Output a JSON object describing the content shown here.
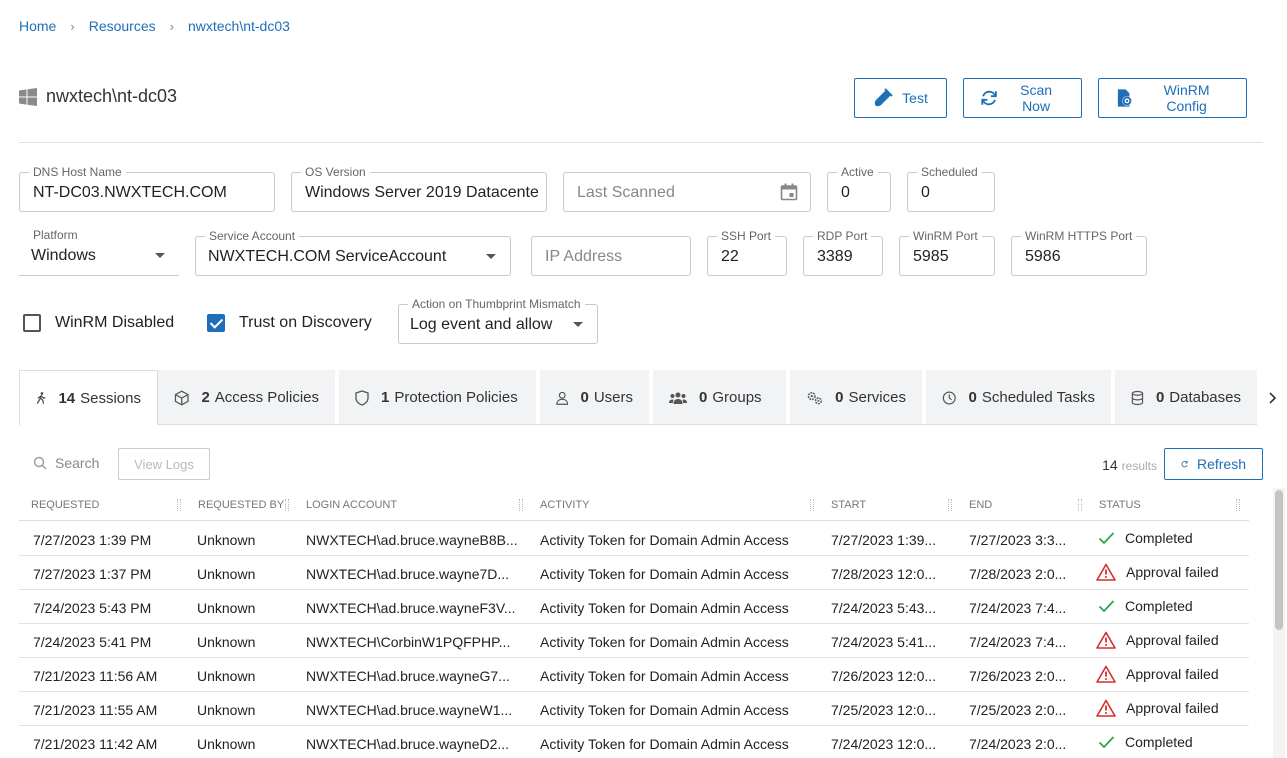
{
  "breadcrumb": {
    "home": "Home",
    "resources": "Resources",
    "current": "nwxtech\\nt-dc03"
  },
  "header": {
    "title": "nwxtech\\nt-dc03"
  },
  "actions": {
    "test": "Test",
    "scan_now": "Scan Now",
    "winrm_config": "WinRM Config"
  },
  "colors": {
    "accent": "#1e6fb8",
    "success": "#2aa84a",
    "error": "#d32f2f"
  },
  "fields": {
    "dns_host_name": {
      "label": "DNS Host Name",
      "value": "NT-DC03.NWXTECH.COM"
    },
    "os_version": {
      "label": "OS Version",
      "value": "Windows Server 2019 Datacente"
    },
    "last_scanned": {
      "placeholder": "Last Scanned"
    },
    "active": {
      "label": "Active",
      "value": "0"
    },
    "scheduled": {
      "label": "Scheduled",
      "value": "0"
    },
    "platform": {
      "label": "Platform",
      "value": "Windows"
    },
    "service_account": {
      "label": "Service Account",
      "value": "NWXTECH.COM ServiceAccount"
    },
    "ip_address": {
      "placeholder": "IP Address"
    },
    "ssh_port": {
      "label": "SSH Port",
      "value": "22"
    },
    "rdp_port": {
      "label": "RDP Port",
      "value": "3389"
    },
    "winrm_port": {
      "label": "WinRM Port",
      "value": "5985"
    },
    "winrm_https_port": {
      "label": "WinRM HTTPS Port",
      "value": "5986"
    },
    "thumbprint_action": {
      "label": "Action on Thumbprint Mismatch",
      "value": "Log event and allow"
    }
  },
  "checkboxes": {
    "winrm_disabled": {
      "label": "WinRM Disabled",
      "checked": false
    },
    "trust_on_discovery": {
      "label": "Trust on Discovery",
      "checked": true
    }
  },
  "tabs": [
    {
      "count": "14",
      "label": "Sessions",
      "icon": "walking-person-icon"
    },
    {
      "count": "2",
      "label": "Access Policies",
      "icon": "cube-icon"
    },
    {
      "count": "1",
      "label": "Protection Policies",
      "icon": "shield-icon"
    },
    {
      "count": "0",
      "label": "Users",
      "icon": "user-icon"
    },
    {
      "count": "0",
      "label": "Groups",
      "icon": "group-icon"
    },
    {
      "count": "0",
      "label": "Services",
      "icon": "gears-icon"
    },
    {
      "count": "0",
      "label": "Scheduled Tasks",
      "icon": "clock-icon"
    },
    {
      "count": "0",
      "label": "Databases",
      "icon": "database-icon"
    }
  ],
  "toolbar": {
    "search_placeholder": "Search",
    "view_logs": "View Logs",
    "results_count": "14",
    "results_label": "results",
    "refresh": "Refresh"
  },
  "table": {
    "columns": [
      "Requested",
      "Requested By",
      "Login Account",
      "Activity",
      "Start",
      "End",
      "Status"
    ],
    "rows": [
      [
        "7/27/2023 1:39 PM",
        "Unknown",
        "NWXTECH\\ad.bruce.wayneB8B...",
        "Activity Token for Domain Admin Access",
        "7/27/2023 1:39...",
        "7/27/2023 3:3...",
        "Completed"
      ],
      [
        "7/27/2023 1:37 PM",
        "Unknown",
        "NWXTECH\\ad.bruce.wayne7D...",
        "Activity Token for Domain Admin Access",
        "7/28/2023 12:0...",
        "7/28/2023 2:0...",
        "Approval failed"
      ],
      [
        "7/24/2023 5:43 PM",
        "Unknown",
        "NWXTECH\\ad.bruce.wayneF3V...",
        "Activity Token for Domain Admin Access",
        "7/24/2023 5:43...",
        "7/24/2023 7:4...",
        "Completed"
      ],
      [
        "7/24/2023 5:41 PM",
        "Unknown",
        "NWXTECH\\CorbinW1PQFPHP...",
        "Activity Token for Domain Admin Access",
        "7/24/2023 5:41...",
        "7/24/2023 7:4...",
        "Approval failed"
      ],
      [
        "7/21/2023 11:56 AM",
        "Unknown",
        "NWXTECH\\ad.bruce.wayneG7...",
        "Activity Token for Domain Admin Access",
        "7/26/2023 12:0...",
        "7/26/2023 2:0...",
        "Approval failed"
      ],
      [
        "7/21/2023 11:55 AM",
        "Unknown",
        "NWXTECH\\ad.bruce.wayneW1...",
        "Activity Token for Domain Admin Access",
        "7/25/2023 12:0...",
        "7/25/2023 2:0...",
        "Approval failed"
      ],
      [
        "7/21/2023 11:42 AM",
        "Unknown",
        "NWXTECH\\ad.bruce.wayneD2...",
        "Activity Token for Domain Admin Access",
        "7/24/2023 12:0...",
        "7/24/2023 2:0...",
        "Completed"
      ]
    ]
  }
}
